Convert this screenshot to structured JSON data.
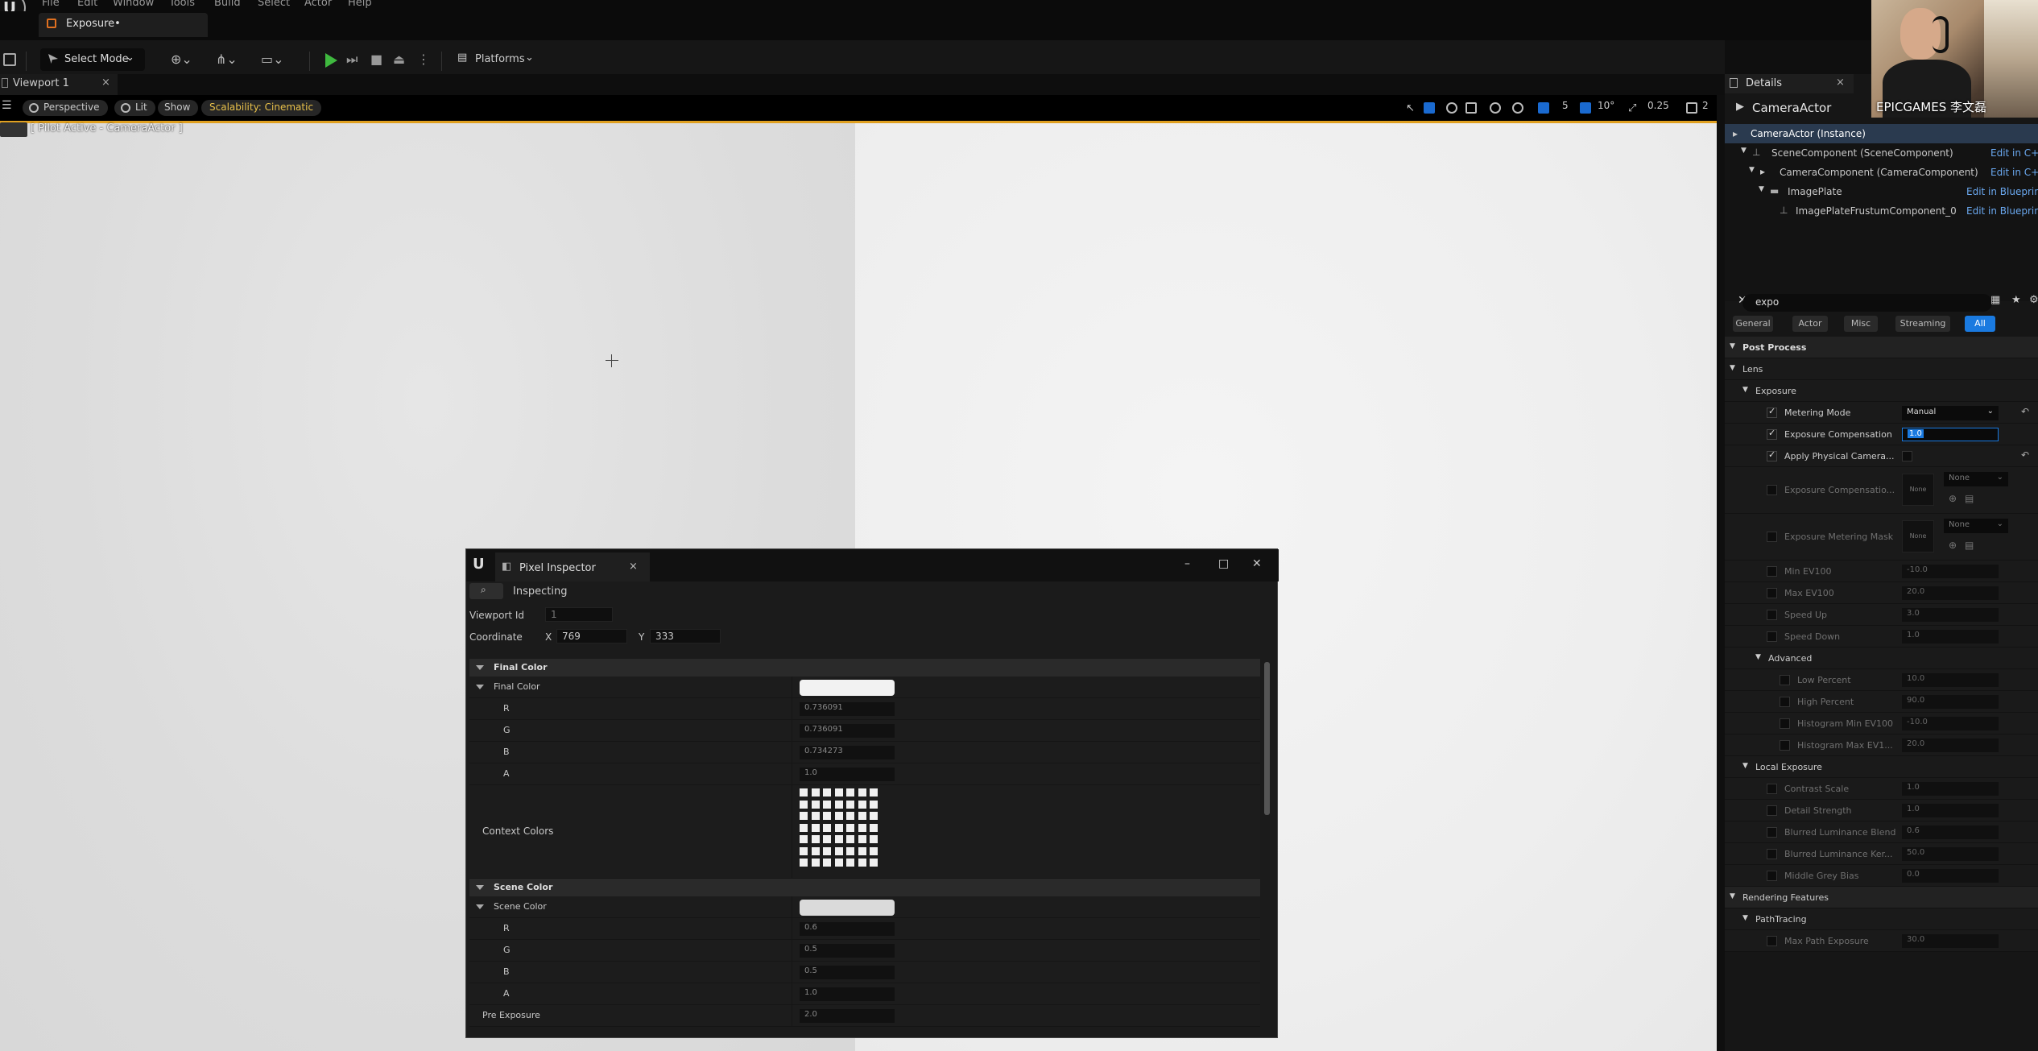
{
  "menu": [
    "File",
    "Edit",
    "Window",
    "Tools",
    "Build",
    "Select",
    "Actor",
    "Help"
  ],
  "level_tab": "Exposure•",
  "toolbar": {
    "select_mode": "Select Mode",
    "platforms": "Platforms"
  },
  "viewport_tab": {
    "label": "Viewport 1",
    "close": "×"
  },
  "viewport_toolbar": {
    "perspective": "Perspective",
    "lit": "Lit",
    "show": "Show",
    "scalability": "Scalability: Cinematic",
    "grid_size": "5",
    "rotation_snap": "10°",
    "scale_snap": "0.25",
    "camera_speed": "2"
  },
  "pilot": "[ Pilot Active - CameraActor ]",
  "pixel_inspector": {
    "title": "Pixel Inspector",
    "close": "×",
    "inspecting": "Inspecting",
    "viewport_id_label": "Viewport Id",
    "viewport_id": "1",
    "coordinate_label": "Coordinate",
    "x_label": "X",
    "x": "769",
    "y_label": "Y",
    "y": "333",
    "final_color_section": "Final Color",
    "final_color_label": "Final Color",
    "final_color_rows": [
      {
        "name": "R",
        "value": "0.736091"
      },
      {
        "name": "G",
        "value": "0.736091"
      },
      {
        "name": "B",
        "value": "0.734273"
      },
      {
        "name": "A",
        "value": "1.0"
      }
    ],
    "context_colors": "Context Colors",
    "scene_color_section": "Scene Color",
    "scene_color_label": "Scene Color",
    "scene_color_rows": [
      {
        "name": "R",
        "value": "0.6"
      },
      {
        "name": "G",
        "value": "0.5"
      },
      {
        "name": "B",
        "value": "0.5"
      },
      {
        "name": "A",
        "value": "1.0"
      }
    ],
    "pre_exposure_label": "Pre Exposure",
    "pre_exposure": "2.0"
  },
  "details": {
    "tab": "Details",
    "close": "×",
    "actor": "CameraActor",
    "tree": [
      {
        "label": "CameraActor (Instance)",
        "link": ""
      },
      {
        "label": "SceneComponent (SceneComponent)",
        "link": "Edit in C++"
      },
      {
        "label": "CameraComponent (CameraComponent)",
        "link": "Edit in C++"
      },
      {
        "label": "ImagePlate",
        "link": "Edit in Blueprint"
      },
      {
        "label": "ImagePlateFrustumComponent_0",
        "link": "Edit in Blueprint"
      }
    ],
    "search": "expo",
    "categories": [
      "General",
      "Actor",
      "Misc",
      "Streaming",
      "All"
    ],
    "post_process": "Post Process",
    "lens": "Lens",
    "exposure": "Exposure",
    "metering_mode_label": "Metering Mode",
    "metering_mode": "Manual",
    "exposure_comp_label": "Exposure Compensation",
    "exposure_comp": "1.0",
    "apply_physical_label": "Apply Physical Camera...",
    "exposure_comp_curve_label": "Exposure Compensatio...",
    "none": "None",
    "exposure_metering_mask_label": "Exposure Metering Mask",
    "min_ev_label": "Min EV100",
    "min_ev": "-10.0",
    "max_ev_label": "Max EV100",
    "max_ev": "20.0",
    "speed_up_label": "Speed Up",
    "speed_up": "3.0",
    "speed_down_label": "Speed Down",
    "speed_down": "1.0",
    "advanced": "Advanced",
    "low_percent_label": "Low Percent",
    "low_percent": "10.0",
    "high_percent_label": "High Percent",
    "high_percent": "90.0",
    "hist_min_label": "Histogram Min EV100",
    "hist_min": "-10.0",
    "hist_max_label": "Histogram Max EV1...",
    "hist_max": "20.0",
    "local_exposure": "Local Exposure",
    "contrast_scale_label": "Contrast Scale",
    "contrast_scale": "1.0",
    "detail_strength_label": "Detail Strength",
    "detail_strength": "1.0",
    "blurred_blend_label": "Blurred Luminance Blend",
    "blurred_blend": "0.6",
    "blurred_kernel_label": "Blurred Luminance Ker...",
    "blurred_kernel": "50.0",
    "middle_grey_label": "Middle Grey Bias",
    "middle_grey": "0.0",
    "rendering_features": "Rendering Features",
    "path_tracing": "PathTracing",
    "max_path_exposure_label": "Max Path Exposure",
    "max_path_exposure": "30.0"
  },
  "webcam_caption": "EPICGAMES 李文磊"
}
